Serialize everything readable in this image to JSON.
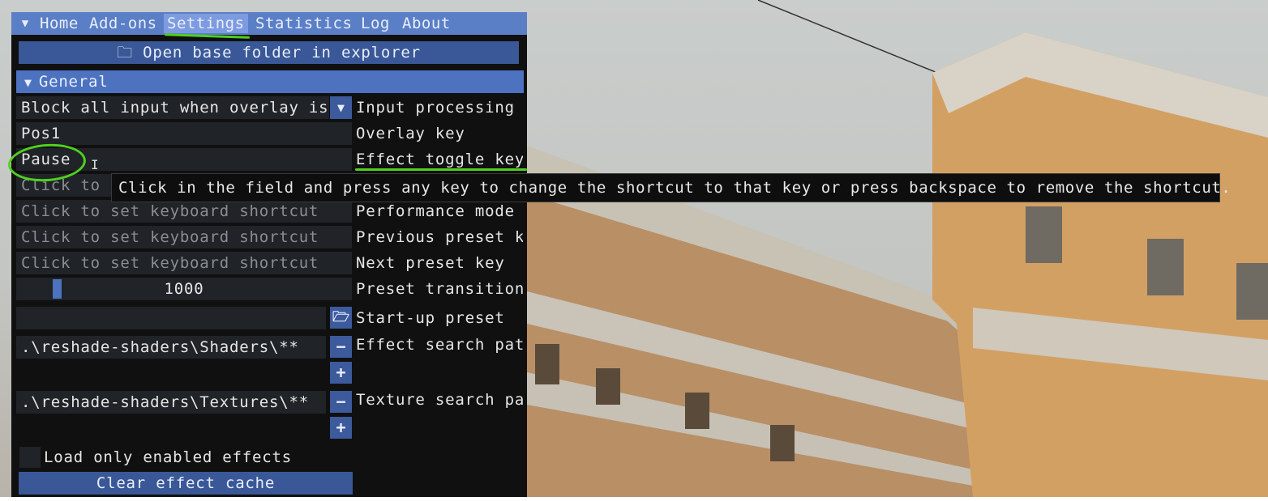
{
  "tabs": [
    {
      "label": "Home"
    },
    {
      "label": "Add-ons"
    },
    {
      "label": "Settings"
    },
    {
      "label": "Statistics"
    },
    {
      "label": "Log"
    },
    {
      "label": "About"
    }
  ],
  "open_folder_button": "Open base folder in explorer",
  "section_header": "General",
  "input_processing": {
    "value": "Block all input when overlay is",
    "label": "Input processing"
  },
  "overlay_key": {
    "value": "Pos1",
    "label": "Overlay key"
  },
  "effect_toggle_key": {
    "value": "Pause",
    "label": "Effect toggle key"
  },
  "row4": {
    "placeholder": "Click to s"
  },
  "performance_mode": {
    "placeholder": "Click to set keyboard shortcut",
    "label": "Performance mode"
  },
  "previous_preset": {
    "placeholder": "Click to set keyboard shortcut",
    "label": "Previous preset ke"
  },
  "next_preset": {
    "placeholder": "Click to set keyboard shortcut",
    "label": "Next preset key"
  },
  "preset_transition": {
    "value": "1000",
    "label": "Preset transition"
  },
  "startup_preset": {
    "value": "",
    "label": "Start-up preset"
  },
  "effect_search_path": {
    "value": ".\\reshade-shaders\\Shaders\\**",
    "label": "Effect search path"
  },
  "texture_search_path": {
    "value": ".\\reshade-shaders\\Textures\\**",
    "label": "Texture search path"
  },
  "load_only_enabled": {
    "label": "Load only enabled effects",
    "checked": false
  },
  "clear_cache_button": "Clear effect cache",
  "tooltip": "Click in the field and press any key to change the shortcut to that key or press backspace to remove the shortcut.",
  "colors": {
    "accent": "#4d72c0",
    "annotation": "#4fd11e",
    "panel_bg": "#101010"
  },
  "icons": {
    "collapse": "triangle-down-icon",
    "folder": "folder-icon",
    "open": "folder-open-icon",
    "minus": "minus-icon",
    "plus": "plus-icon"
  }
}
